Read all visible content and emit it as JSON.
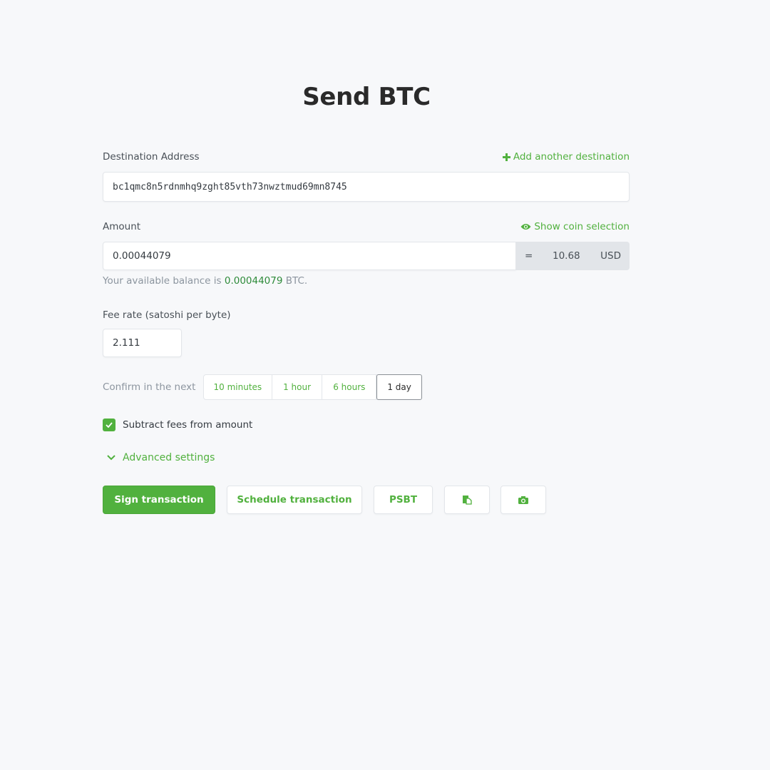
{
  "page": {
    "title": "Send BTC"
  },
  "destination": {
    "label": "Destination Address",
    "add_link": "Add another destination",
    "add_icon": "plus-icon",
    "value": "bc1qmc8n5rdnmhq9zght85vth73nwztmud69mn8745"
  },
  "amount": {
    "label": "Amount",
    "coin_link": "Show coin selection",
    "coin_icon": "eye-icon",
    "value": "0.00044079",
    "equals": "=",
    "fiat_value": "10.68",
    "fiat_currency": "USD",
    "balance_prefix": "Your available balance is ",
    "balance_value": "0.00044079",
    "balance_suffix": " BTC."
  },
  "fee": {
    "label": "Fee rate (satoshi per byte)",
    "value": "2.111"
  },
  "confirm": {
    "label": "Confirm in the next",
    "options": [
      {
        "label": "10 minutes",
        "active": false
      },
      {
        "label": "1 hour",
        "active": false
      },
      {
        "label": "6 hours",
        "active": false
      },
      {
        "label": "1 day",
        "active": true
      }
    ]
  },
  "subtract_fees": {
    "label": "Subtract fees from amount",
    "checked": true
  },
  "advanced": {
    "label": "Advanced settings",
    "icon": "chevron-down-icon"
  },
  "actions": {
    "sign": "Sign transaction",
    "schedule": "Schedule transaction",
    "psbt": "PSBT",
    "paste_icon": "paste-icon",
    "camera_icon": "camera-icon"
  },
  "colors": {
    "accent": "#51b13e",
    "background": "#f7f8fa"
  }
}
